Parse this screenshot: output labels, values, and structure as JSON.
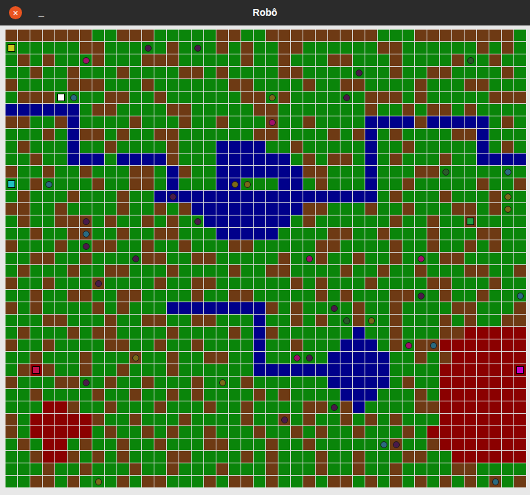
{
  "window": {
    "title": "Robô",
    "close": "×",
    "minimize": "_"
  },
  "terrain": {
    "g": "#0a850a",
    "b": "#6e3a14",
    "w": "#00008b",
    "r": "#8b0000"
  },
  "grid": [
    "bbbbbbbggbbbgggggbbggbbbbbbbbbgggbbbbbbbbg",
    "ggggggbbgggggbgggbgbggbbggggggbbggggggbgbg",
    "gbgbgggbgggbbbgggggbggbgggbbgggbggggbggbgg",
    "ggbggbgggbggggbbgbggggbbgggggggbggbbggggbg",
    "bggggbbbgggbggggggbbggggbggbbggggbgggbbggg",
    "gbbbggggbbggbggggggbbgbggggggbbbgbgggggbbb",
    "wwwwwwgbbggggbbgggggbbgggggggbggbgbbgbgggg",
    "bbggbwggggbgggbggbgggbggbggggwwwwbwwwwwgbg",
    "gggbgwbbgbggbbggggggbbggggbgbwgbggggbbwggg",
    "gbgggwggbggggbgggwwwwggbgggggwggbgggggwgbg",
    "ggbggwwwgwwwwbgggwwwwwwgbgbbgwgbgggbggwwww",
    "bggbggbgggbbgwbggwwwwwwwbbgggwgggbbggggggg",
    "ggbggggbggbbgwgggwwgggwwgbgggwggbgggggbggb",
    "gbgggbgggbggwwwwwwwwwwwwwwwwwwgbgggbgggbgg",
    "bbggbggggbggbgbwwwwwwwwwbbgggbggbgggbbgbgg",
    "gbggbbbgbggbgbggwwwwwwwgbggggggbggbggbgggg",
    "ggbggbbggbggbbgggwwwwwggggbbggbgggbgggbbgg",
    "bgggbggbbggbggbgggbbgggggbbggggbggbggbgbg",
    "ggbbggbggggbbggbbgggggbggbggbggbgggbbggggg",
    "gbgggbggbbgggbggggbggbbggggbggbggbgggbbggb",
    "bggbgggbggggbggbbggggggbgbgggbggggbbgggbgg",
    "ggbggbbggbbggggbggbbgggggbgbgggbbggbggbggg",
    "bgbggggbgbgggwwwwwwwwbgbggggbggbggggbbgggb",
    "gggbbgggbggbbggbbgggwggbgbggbggbgggbgbggbb",
    "gbgggbgbbggggbggggbgwbggggggwggbgggbbrrrrr",
    "bggbggggbbggbggbggggwggbgggwwwgbgbbrrrrrrr",
    "ggbgggbgggbggbggbbggwgggggwwwwwggbgbrrrrrr",
    "gbrbggbggbgggbggggggwwwwwwwwwwwggggrrrrrrr",
    "bgggbbggbggbgggbgggbggggggwwwwwgbggrrrrrrr",
    "ggbggggbggbggbgbggggbgbggggwwwgggbgrrrrrrr",
    "gggrrbggbgggbgggbggbggggbbgbwggggbbrrrrrrr",
    "bgrrrrrbggbgggbggggbggbgbggbgbgbgggrrrrrrr",
    "bgrrrrrgbggbgbggbgggbggbgbggbgggbgrrrrrrrr",
    "gbgrrgbggbggbgggbbgggbggbggggggbggbrrrrrrr",
    "ggbrrbgbgbgggbbggggbgbgggbggbgggbbggrrrrrr",
    "gggbggbgggbggbgggbgggbgggbggbggbggggbbggg",
    "ggbbgbgggbgbbgggbgbbgbggbgbbgbgbgbgbgbgbgb"
  ],
  "markers": [
    {
      "kind": "square",
      "row": 1,
      "col": 0,
      "color": "#c8c81e"
    },
    {
      "kind": "square",
      "row": 5,
      "col": 4,
      "color": "#ffffff"
    },
    {
      "kind": "square",
      "row": 12,
      "col": 0,
      "color": "#20c0c0"
    },
    {
      "kind": "square",
      "row": 15,
      "col": 37,
      "color": "#20a040"
    },
    {
      "kind": "square",
      "row": 27,
      "col": 2,
      "color": "#c0104a"
    },
    {
      "kind": "square",
      "row": 27,
      "col": 41,
      "color": "#c000c0"
    },
    {
      "kind": "circle",
      "row": 2,
      "col": 6,
      "color": "#a0106a"
    },
    {
      "kind": "circle",
      "row": 1,
      "col": 11,
      "color": "#4a1a4a"
    },
    {
      "kind": "circle",
      "row": 1,
      "col": 15,
      "color": "#4a1a4a"
    },
    {
      "kind": "circle",
      "row": 3,
      "col": 28,
      "color": "#4a1a4a"
    },
    {
      "kind": "circle",
      "row": 2,
      "col": 37,
      "color": "#2a5a2a"
    },
    {
      "kind": "circle",
      "row": 5,
      "col": 5,
      "color": "#2a6a80"
    },
    {
      "kind": "circle",
      "row": 5,
      "col": 21,
      "color": "#7a6a18"
    },
    {
      "kind": "circle",
      "row": 5,
      "col": 27,
      "color": "#4a1a4a"
    },
    {
      "kind": "circle",
      "row": 7,
      "col": 21,
      "color": "#a0106a"
    },
    {
      "kind": "circle",
      "row": 11,
      "col": 35,
      "color": "#2a5a2a"
    },
    {
      "kind": "circle",
      "row": 12,
      "col": 3,
      "color": "#2a6a80"
    },
    {
      "kind": "circle",
      "row": 12,
      "col": 18,
      "color": "#7a6a18"
    },
    {
      "kind": "circle",
      "row": 12,
      "col": 19,
      "color": "#7a6a18"
    },
    {
      "kind": "circle",
      "row": 11,
      "col": 40,
      "color": "#2a6a80"
    },
    {
      "kind": "circle",
      "row": 13,
      "col": 40,
      "color": "#7a6a18"
    },
    {
      "kind": "circle",
      "row": 14,
      "col": 40,
      "color": "#7a6a18"
    },
    {
      "kind": "circle",
      "row": 13,
      "col": 13,
      "color": "#4a1a4a"
    },
    {
      "kind": "circle",
      "row": 15,
      "col": 6,
      "color": "#4a1a4a"
    },
    {
      "kind": "circle",
      "row": 15,
      "col": 15,
      "color": "#4a1a4a"
    },
    {
      "kind": "circle",
      "row": 16,
      "col": 6,
      "color": "#2a6a80"
    },
    {
      "kind": "circle",
      "row": 17,
      "col": 6,
      "color": "#4a1a4a"
    },
    {
      "kind": "circle",
      "row": 18,
      "col": 10,
      "color": "#4a1a4a"
    },
    {
      "kind": "circle",
      "row": 18,
      "col": 24,
      "color": "#a0106a"
    },
    {
      "kind": "circle",
      "row": 18,
      "col": 33,
      "color": "#a0106a"
    },
    {
      "kind": "circle",
      "row": 20,
      "col": 7,
      "color": "#4a1a4a"
    },
    {
      "kind": "circle",
      "row": 21,
      "col": 33,
      "color": "#4a1a4a"
    },
    {
      "kind": "circle",
      "row": 21,
      "col": 41,
      "color": "#2a6a80"
    },
    {
      "kind": "circle",
      "row": 22,
      "col": 26,
      "color": "#4a1a4a"
    },
    {
      "kind": "circle",
      "row": 23,
      "col": 27,
      "color": "#2a5a2a"
    },
    {
      "kind": "circle",
      "row": 23,
      "col": 29,
      "color": "#7a6a18"
    },
    {
      "kind": "circle",
      "row": 25,
      "col": 32,
      "color": "#a0106a"
    },
    {
      "kind": "circle",
      "row": 25,
      "col": 34,
      "color": "#2a6a80"
    },
    {
      "kind": "circle",
      "row": 26,
      "col": 10,
      "color": "#7a6a18"
    },
    {
      "kind": "circle",
      "row": 26,
      "col": 23,
      "color": "#a0106a"
    },
    {
      "kind": "circle",
      "row": 26,
      "col": 24,
      "color": "#4a1a4a"
    },
    {
      "kind": "circle",
      "row": 28,
      "col": 6,
      "color": "#4a1a4a"
    },
    {
      "kind": "circle",
      "row": 28,
      "col": 17,
      "color": "#7a6a18"
    },
    {
      "kind": "circle",
      "row": 30,
      "col": 26,
      "color": "#4a1a4a"
    },
    {
      "kind": "circle",
      "row": 31,
      "col": 22,
      "color": "#4a1a4a"
    },
    {
      "kind": "circle",
      "row": 33,
      "col": 30,
      "color": "#2a6a80"
    },
    {
      "kind": "circle",
      "row": 33,
      "col": 31,
      "color": "#4a1a4a"
    },
    {
      "kind": "circle",
      "row": 36,
      "col": 7,
      "color": "#7a6a18"
    },
    {
      "kind": "circle",
      "row": 36,
      "col": 39,
      "color": "#2a6a80"
    }
  ]
}
